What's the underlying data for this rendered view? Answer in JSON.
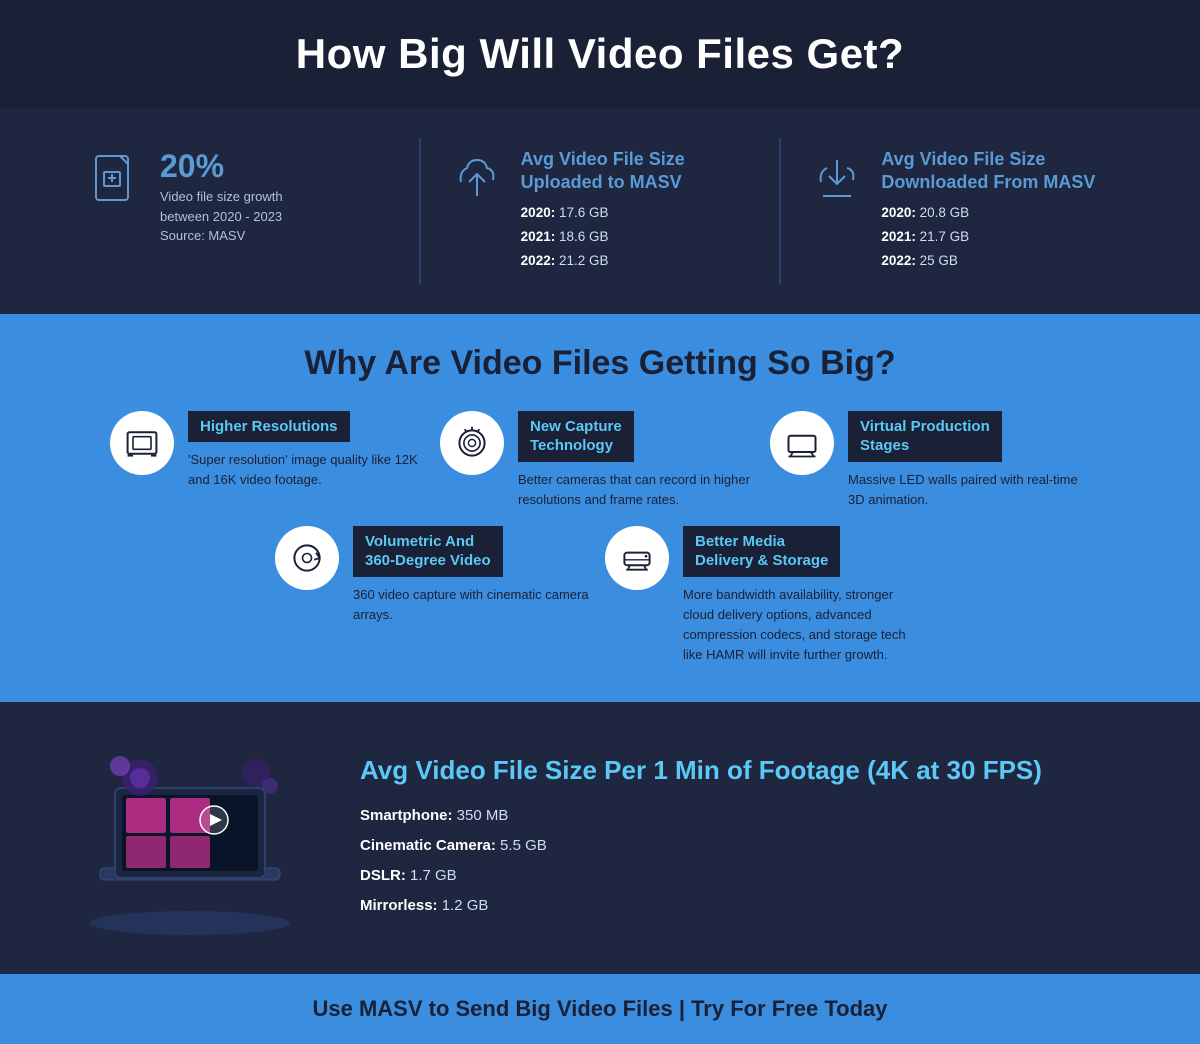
{
  "header": {
    "title": "How Big Will Video Files Get?"
  },
  "stats": {
    "growth": {
      "pct": "20%",
      "desc": "Video file size growth\nbetween 2020 - 2023\nSource: MASV"
    },
    "uploaded": {
      "title": "Avg Video File Size\nUploaded to MASV",
      "2020": "17.6 GB",
      "2021": "18.6 GB",
      "2022": "21.2 GB"
    },
    "downloaded": {
      "title": "Avg Video File Size\nDownloaded From MASV",
      "2020": "20.8 GB",
      "2021": "21.7 GB",
      "2022": "25 GB"
    }
  },
  "why": {
    "title": "Why Are Video Files Getting So Big?",
    "items": [
      {
        "label": "Higher Resolutions",
        "desc": "'Super resolution' image quality like 12K and 16K video footage."
      },
      {
        "label": "New Capture\nTechnology",
        "desc": "Better cameras that can record in higher resolutions and frame rates."
      },
      {
        "label": "Virtual Production\nStages",
        "desc": "Massive LED walls paired with real-time 3D animation."
      },
      {
        "label": "Volumetric And\n360-Degree Video",
        "desc": "360 video capture with cinematic camera arrays."
      },
      {
        "label": "Better Media\nDelivery & Storage",
        "desc": "More bandwidth availability, stronger cloud delivery options, advanced compression codecs, and storage tech like HAMR will invite further growth."
      }
    ]
  },
  "bottom": {
    "title": "Avg Video File Size Per 1 Min of Footage (4K at 30 FPS)",
    "items": [
      {
        "device": "Smartphone:",
        "size": "350 MB"
      },
      {
        "device": "Cinematic Camera:",
        "size": "5.5 GB"
      },
      {
        "device": "DSLR:",
        "size": "1.7 GB"
      },
      {
        "device": "Mirrorless:",
        "size": "1.2 GB"
      }
    ]
  },
  "footer": {
    "text": "Use MASV to Send Big Video Files | Try For Free Today"
  }
}
